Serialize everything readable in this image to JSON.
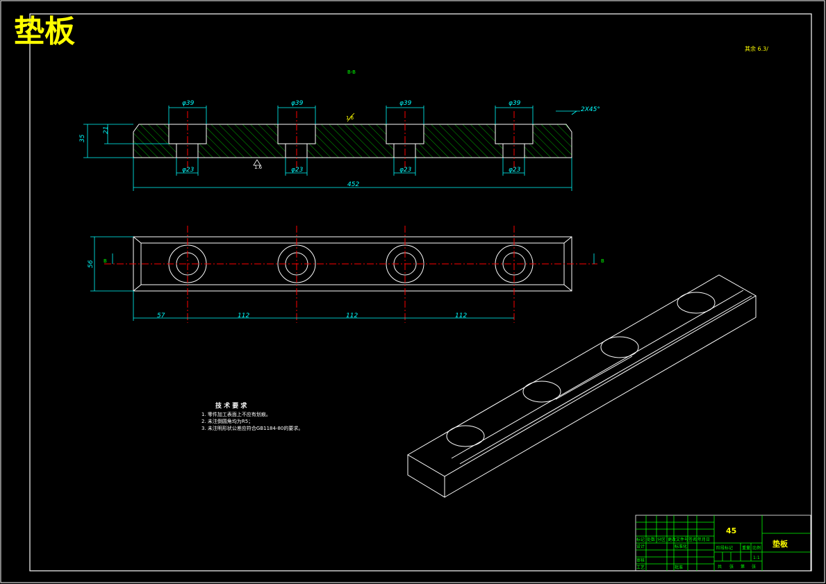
{
  "title": "垫板",
  "roughness_note": "其余 6.3/",
  "section_label": "B-B",
  "dims": {
    "dia_big": "φ39",
    "dia_small": "φ23",
    "length": "452",
    "height_total": "35",
    "height_counter": "21",
    "chamfer": "2X45°",
    "width": "56",
    "pitch_first": "57",
    "pitch": "112",
    "roughness_top": "1.6",
    "roughness_bottom": "1.6",
    "section_mark": "B"
  },
  "tech_req": {
    "heading": "技 术 要 求",
    "items": [
      "1. 零件加工表面上不应有划痕。",
      "2. 未注倒圆角均为R5；",
      "3. 未注明形状公差应符合GB1184-80的要求。"
    ]
  },
  "title_block": {
    "material": "45",
    "part_name": "垫板",
    "scale": "1:1",
    "row_labels": [
      "标记",
      "处数",
      "分区",
      "更改文件号",
      "签名",
      "年月日"
    ],
    "side_labels": [
      "设计",
      "",
      "审核",
      "工艺"
    ],
    "mid_labels": [
      "标准化",
      "",
      "批准"
    ],
    "stage_labels": [
      "阶段标记",
      "重量",
      "比例"
    ],
    "sheet_labels": [
      "共",
      "张",
      "第",
      "张"
    ]
  }
}
